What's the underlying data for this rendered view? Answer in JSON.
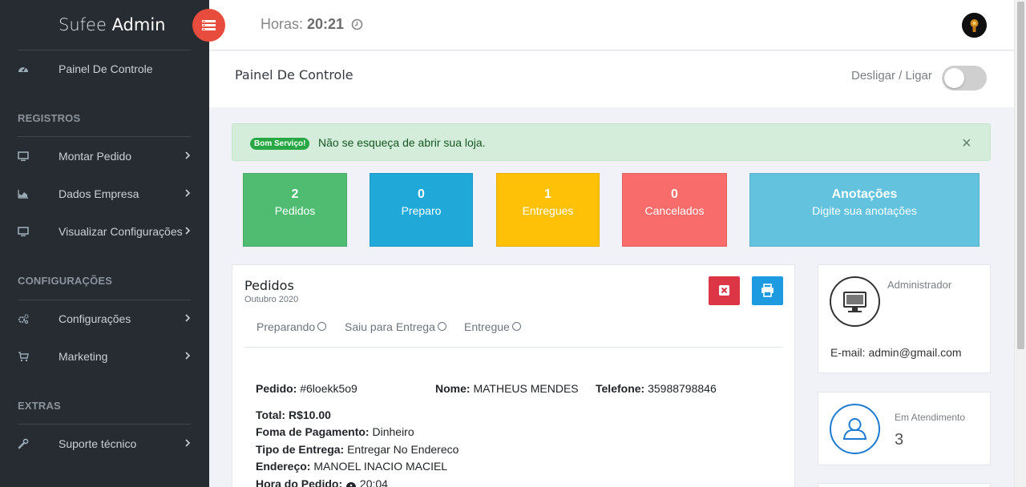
{
  "sidebar": {
    "brand_light": "Sufee",
    "brand_bold": "Admin",
    "dashboard_label": "Painel De Controle",
    "sections": {
      "registros": "REGISTROS",
      "configuracoes": "CONFIGURAÇÕES",
      "extras": "EXTRAS"
    },
    "items": {
      "montar": "Montar Pedido",
      "dados": "Dados Empresa",
      "visualizar": "Visualizar Configurações",
      "config": "Configurações",
      "marketing": "Marketing",
      "suporte": "Suporte técnico"
    }
  },
  "header": {
    "clock_label": "Horas:",
    "clock_time": "20:21",
    "icons": [
      "menu-toggle-icon",
      "clock-icon",
      "user-avatar"
    ]
  },
  "page": {
    "title": "Painel De Controle",
    "toggle_label": "Desligar / Ligar",
    "toggle_on": false
  },
  "alert": {
    "badge": "Bom Serviço!",
    "message": "Não se esqueça de abrir sua loja.",
    "close": "×"
  },
  "stats": [
    {
      "number": "2",
      "label": "Pedidos",
      "color": "#4fbc72"
    },
    {
      "number": "0",
      "label": "Preparo",
      "color": "#20a8d8"
    },
    {
      "number": "1",
      "label": "Entregues",
      "color": "#ffc107"
    },
    {
      "number": "0",
      "label": "Cancelados",
      "color": "#f86c6b"
    }
  ],
  "notes": {
    "title": "Anotações",
    "subtitle": "Digite sua anotações",
    "color": "#63c2de"
  },
  "orders": {
    "title": "Pedidos",
    "subtitle": "Outubro 2020",
    "status_options": [
      "Preparando",
      "Saiu para Entrega",
      "Entregue"
    ],
    "buttons": {
      "cancel_color": "#dc3545",
      "print_color": "#1e9be0"
    },
    "order": {
      "pedido_label": "Pedido:",
      "pedido": "#6loekk5o9",
      "nome_label": "Nome:",
      "nome": "MATHEUS MENDES",
      "telefone_label": "Telefone:",
      "telefone": "35988798846",
      "total_label": "Total:",
      "total": "R$10.00",
      "pagamento_label": "Foma de Pagamento:",
      "pagamento": "Dinheiro",
      "entrega_label": "Tipo de Entrega:",
      "entrega": "Entregar No Endereco",
      "endereco_label": "Endereço:",
      "endereco": "MANOEL INACIO MACIEL",
      "hora_label": "Hora do Pedido:",
      "hora": "20:04"
    }
  },
  "admin_card": {
    "role": "Administrador",
    "email": "E-mail: admin@gmail.com"
  },
  "attendance_card": {
    "label": "Em Atendimento",
    "count": "3"
  }
}
